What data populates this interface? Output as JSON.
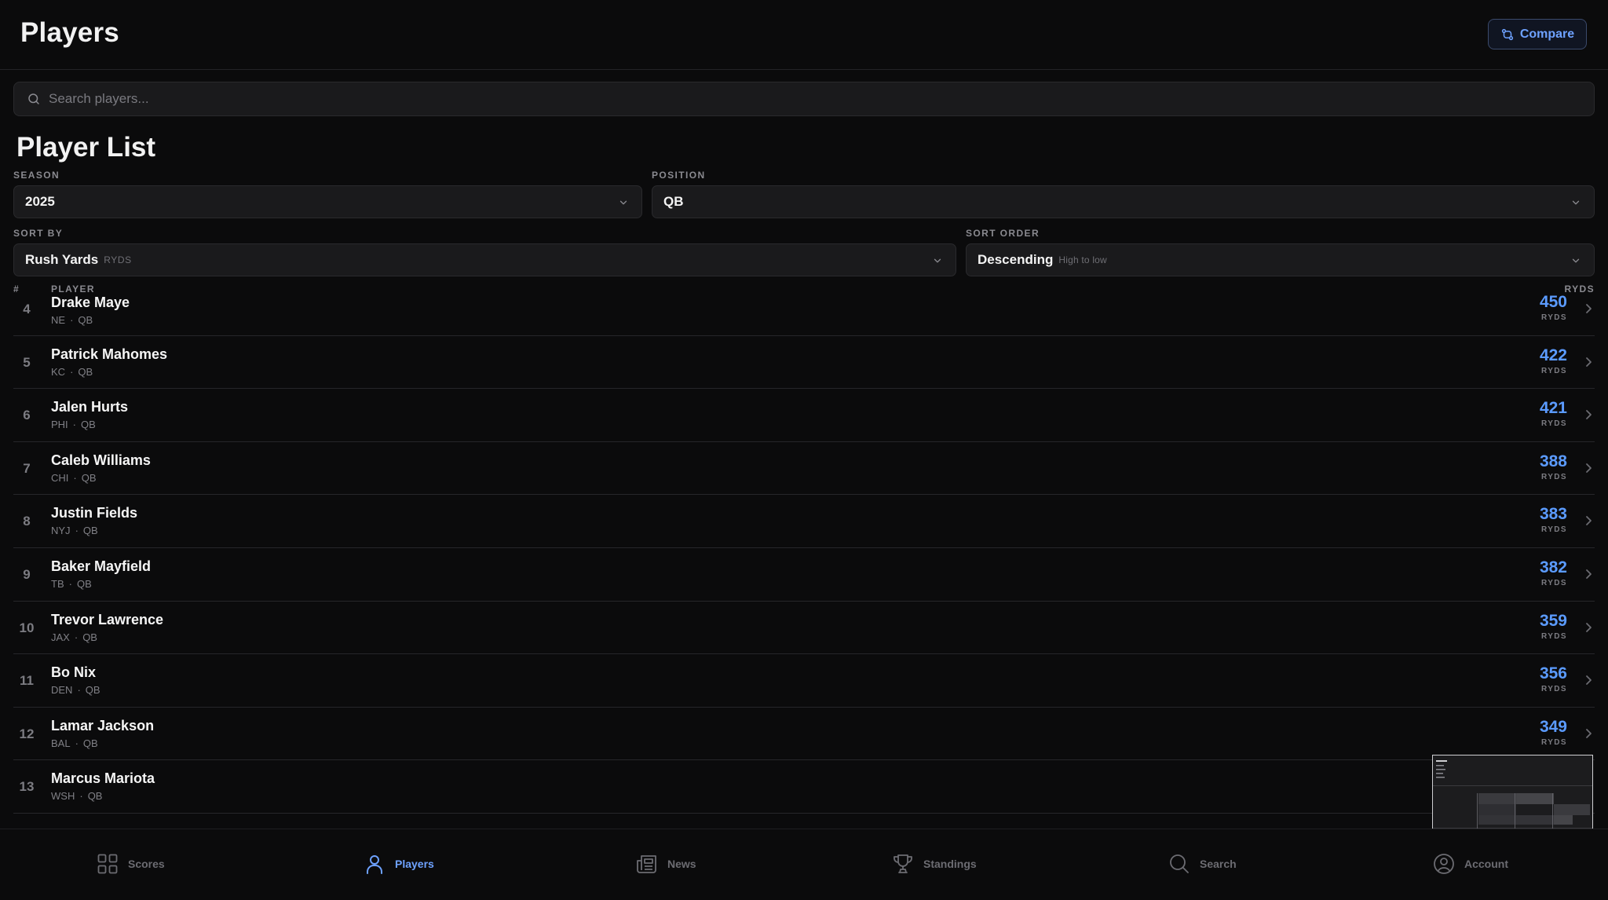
{
  "header": {
    "title": "Players",
    "compare_label": "Compare"
  },
  "search": {
    "placeholder": "Search players..."
  },
  "list_title": "Player List",
  "filters": {
    "season": {
      "label": "SEASON",
      "value": "2025"
    },
    "position": {
      "label": "POSITION",
      "value": "QB"
    },
    "sort_by": {
      "label": "SORT BY",
      "value": "Rush Yards",
      "hint": "RYDS"
    },
    "sort_order": {
      "label": "SORT ORDER",
      "value": "Descending",
      "hint": "High to low"
    }
  },
  "table": {
    "col_rank": "#",
    "col_player": "PLAYER",
    "col_stat": "RYDS",
    "rows": [
      {
        "rank": "4",
        "name": "Drake Maye",
        "team": "NE",
        "pos": "QB",
        "value": "450",
        "unit": "RYDS"
      },
      {
        "rank": "5",
        "name": "Patrick Mahomes",
        "team": "KC",
        "pos": "QB",
        "value": "422",
        "unit": "RYDS"
      },
      {
        "rank": "6",
        "name": "Jalen Hurts",
        "team": "PHI",
        "pos": "QB",
        "value": "421",
        "unit": "RYDS"
      },
      {
        "rank": "7",
        "name": "Caleb Williams",
        "team": "CHI",
        "pos": "QB",
        "value": "388",
        "unit": "RYDS"
      },
      {
        "rank": "8",
        "name": "Justin Fields",
        "team": "NYJ",
        "pos": "QB",
        "value": "383",
        "unit": "RYDS"
      },
      {
        "rank": "9",
        "name": "Baker Mayfield",
        "team": "TB",
        "pos": "QB",
        "value": "382",
        "unit": "RYDS"
      },
      {
        "rank": "10",
        "name": "Trevor Lawrence",
        "team": "JAX",
        "pos": "QB",
        "value": "359",
        "unit": "RYDS"
      },
      {
        "rank": "11",
        "name": "Bo Nix",
        "team": "DEN",
        "pos": "QB",
        "value": "356",
        "unit": "RYDS"
      },
      {
        "rank": "12",
        "name": "Lamar Jackson",
        "team": "BAL",
        "pos": "QB",
        "value": "349",
        "unit": "RYDS"
      },
      {
        "rank": "13",
        "name": "Marcus Mariota",
        "team": "WSH",
        "pos": "QB",
        "value": "",
        "unit": ""
      }
    ]
  },
  "bottom_nav": {
    "items": [
      {
        "label": "Scores",
        "icon": "grid-icon",
        "active": false
      },
      {
        "label": "Players",
        "icon": "person-icon",
        "active": true
      },
      {
        "label": "News",
        "icon": "newspaper-icon",
        "active": false
      },
      {
        "label": "Standings",
        "icon": "trophy-icon",
        "active": false
      },
      {
        "label": "Search",
        "icon": "search-icon",
        "active": false
      },
      {
        "label": "Account",
        "icon": "user-circle-icon",
        "active": false
      }
    ]
  },
  "colors": {
    "accent": "#5b9bff",
    "background": "#0b0b0c",
    "surface": "#1a1a1c"
  }
}
